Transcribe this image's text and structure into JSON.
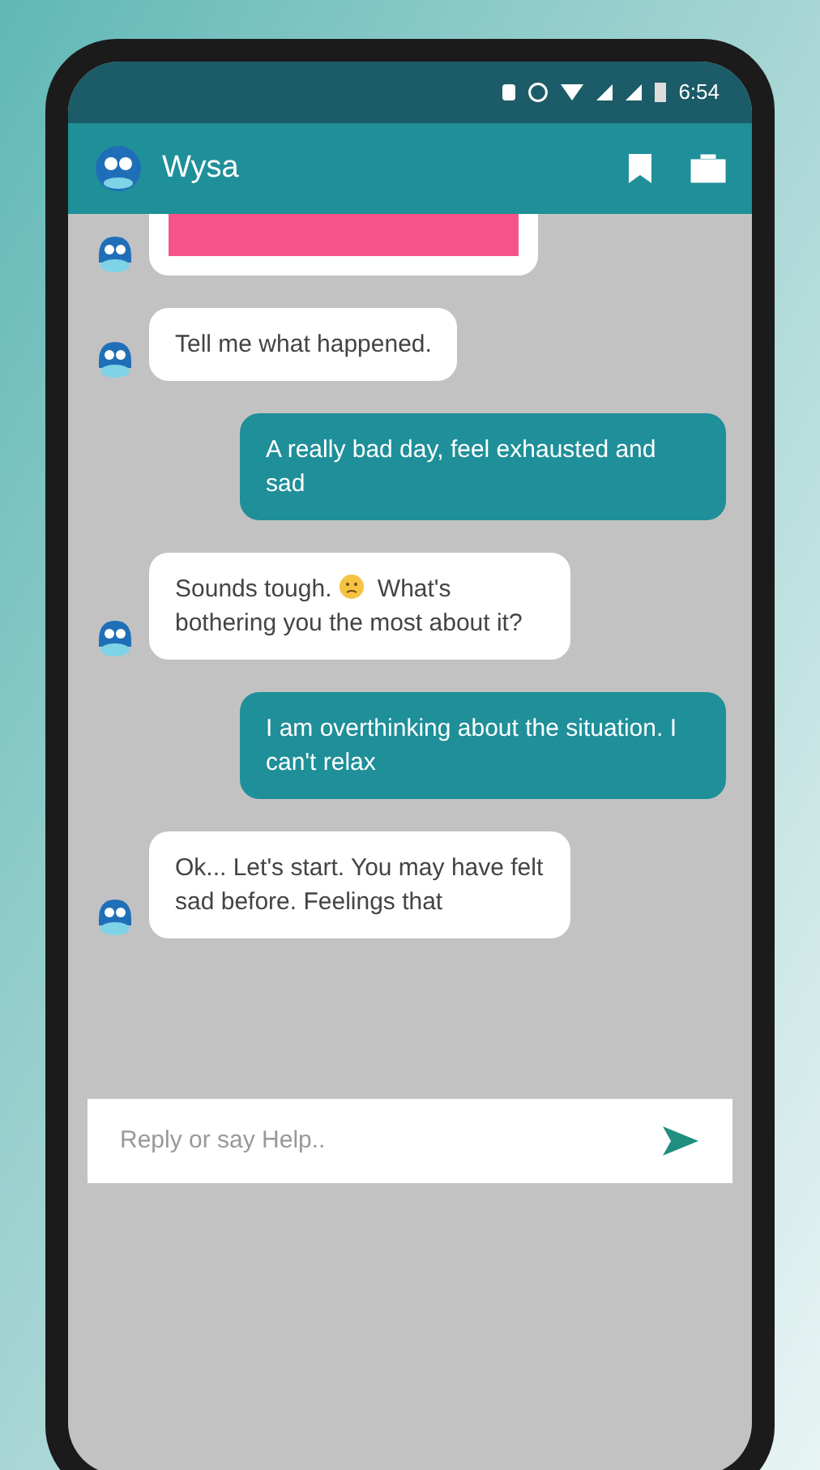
{
  "status_bar": {
    "time": "6:54"
  },
  "app_bar": {
    "title": "Wysa"
  },
  "messages": [
    {
      "kind": "card"
    },
    {
      "kind": "bot",
      "text": "Tell me what happened."
    },
    {
      "kind": "user",
      "text": "A really bad day, feel exhausted and sad"
    },
    {
      "kind": "bot",
      "text": "Sounds tough.",
      "emoji": true,
      "text_after": "What's bothering you the most about it?"
    },
    {
      "kind": "user",
      "text": "I am overthinking about the situation. I can't relax"
    },
    {
      "kind": "bot",
      "text": "Ok... Let's start. You may have felt sad before. Feelings that"
    }
  ],
  "composer": {
    "placeholder": "Reply or say Help.."
  }
}
